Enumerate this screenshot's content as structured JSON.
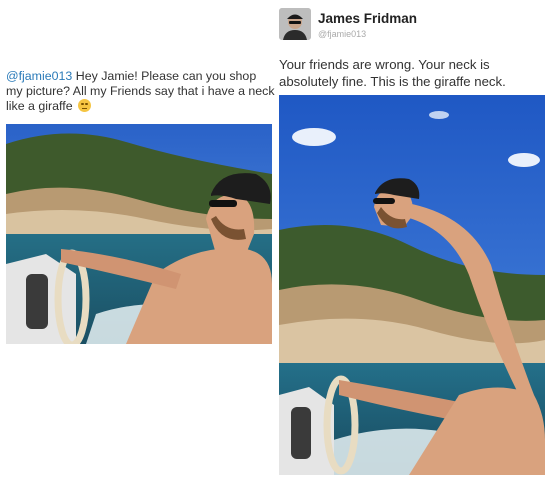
{
  "request": {
    "handle": "@fjamie013",
    "text": " Hey Jamie! Please can you shop my picture? All my Friends say that i have a neck like a giraffe "
  },
  "response": {
    "author_name": "James Fridman",
    "author_handle": "@fjamie013",
    "text": "Your friends are wrong. Your neck is absolutely fine. This is the giraffe neck."
  },
  "colors": {
    "handle": "#2b7bb9",
    "sky": "#2f6fd6",
    "sea": "#1e6f8c"
  },
  "icons": {
    "emoji": "relieved-face-emoji",
    "avatar": "author-avatar"
  }
}
